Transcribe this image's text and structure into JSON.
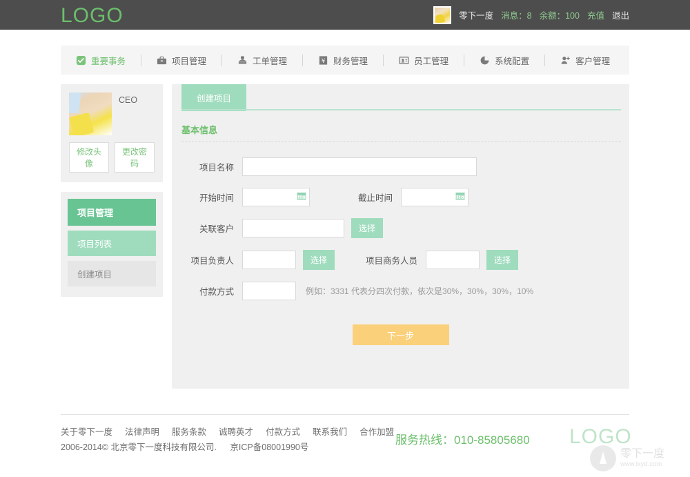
{
  "brand": {
    "logo": "LOGO",
    "footer_logo": "LOGO",
    "accent_green": "#6cbf6c",
    "accent_mid_green": "#9fdcbd",
    "accent_dark_green": "#68c493",
    "accent_orange": "#fbd07a",
    "header_bg": "#4d4d4d",
    "panel_bg": "#f0f0f0"
  },
  "header": {
    "user_name": "零下一度",
    "messages": "消息：8",
    "balance": "余额：100",
    "recharge": "充值",
    "logout": "退出"
  },
  "nav": {
    "items": [
      {
        "label": "重要事务",
        "icon": "checkbox-check-icon",
        "active": true
      },
      {
        "label": "项目管理",
        "icon": "briefcase-icon",
        "active": false
      },
      {
        "label": "工单管理",
        "icon": "envelope-stamp-icon",
        "active": false
      },
      {
        "label": "财务管理",
        "icon": "yuan-currency-icon",
        "active": false
      },
      {
        "label": "员工管理",
        "icon": "id-card-icon",
        "active": false
      },
      {
        "label": "系统配置",
        "icon": "pie-chart-icon",
        "active": false
      },
      {
        "label": "客户管理",
        "icon": "user-add-icon",
        "active": false
      }
    ]
  },
  "sidebar": {
    "role": "CEO",
    "change_avatar": "修改头像",
    "change_password": "更改密码",
    "menu_head": "项目管理",
    "menu_items": [
      {
        "label": "项目列表",
        "state": "highlighted"
      },
      {
        "label": "创建项目",
        "state": "dim"
      }
    ]
  },
  "content": {
    "tab": "创建项目",
    "section_title": "基本信息",
    "fields": {
      "project_name": {
        "label": "项目名称",
        "value": "",
        "placeholder": ""
      },
      "start_time": {
        "label": "开始时间",
        "value": "",
        "placeholder": ""
      },
      "end_time": {
        "label": "截止时间",
        "value": "",
        "placeholder": ""
      },
      "related_customer": {
        "label": "关联客户",
        "value": "",
        "placeholder": ""
      },
      "project_owner": {
        "label": "项目负责人",
        "value": "",
        "placeholder": ""
      },
      "business_staff": {
        "label": "项目商务人员",
        "value": "",
        "placeholder": ""
      },
      "payment_method": {
        "label": "付款方式",
        "value": "",
        "placeholder": ""
      }
    },
    "select_button": "选择",
    "payment_hint": "例如：3331 代表分四次付款，依次是30%，30%，30%，10%",
    "submit": "下一步"
  },
  "footer": {
    "links": [
      "关于零下一度",
      "法律声明",
      "服务条款",
      "诚聘英才",
      "付款方式",
      "联系我们",
      "合作加盟"
    ],
    "copyright": "2006-2014© 北京零下一度科技有限公司.",
    "icp": "京ICP备08001990号",
    "hotline": "服务热线：010-85805680",
    "watermark_name": "零下一度",
    "watermark_url": "www.lxyd.com"
  }
}
